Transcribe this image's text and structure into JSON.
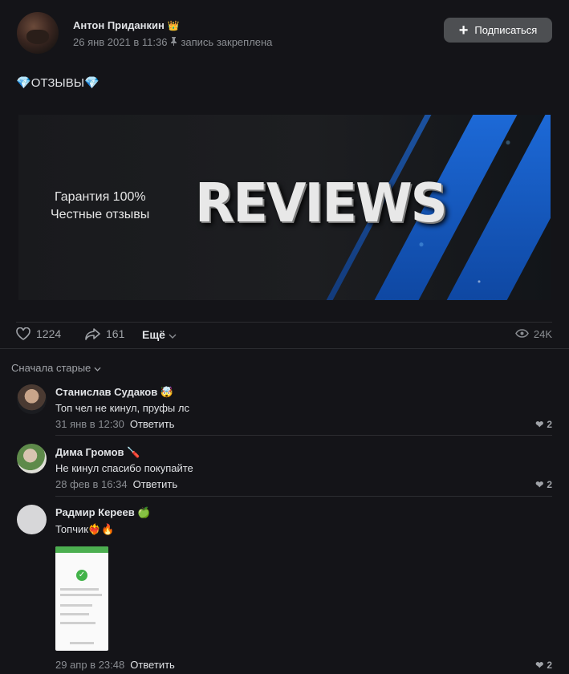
{
  "post": {
    "author": "Антон Приданкин",
    "author_badge": "👑",
    "date": "26 янв 2021 в 11:36",
    "pinned_note": "запись закреплена",
    "subscribe_label": "Подписаться",
    "title": "ОТЗЫВЫ",
    "title_emoji": "💎",
    "banner": {
      "line1": "Гарантия 100%",
      "line2": "Честные отзывы",
      "headline": "REVIEWS"
    },
    "likes": "1224",
    "shares": "161",
    "more_label": "Ещё",
    "views": "24K"
  },
  "comments_sort": "Сначала старые",
  "comments": [
    {
      "name": "Станислав Судаков",
      "badge": "🤯",
      "text": "Топ чел не кинул, пруфы лс",
      "date": "31 янв в 12:30",
      "reply": "Ответить",
      "likes": "2"
    },
    {
      "name": "Дима Громов",
      "badge": "🪛",
      "text": "Не кинул спасибо покупайте",
      "date": "28 фев в 16:34",
      "reply": "Ответить",
      "likes": "2"
    },
    {
      "name": "Радмир Кереев",
      "badge": "🍏",
      "text": "Топчик",
      "text_emoji": "❤️‍🔥🔥",
      "date": "29 апр в 23:48",
      "reply": "Ответить",
      "likes": "2"
    }
  ],
  "colors": {
    "background": "#141418",
    "accent_blue": "#1f6fe0",
    "button_gray": "#4d4f52"
  }
}
